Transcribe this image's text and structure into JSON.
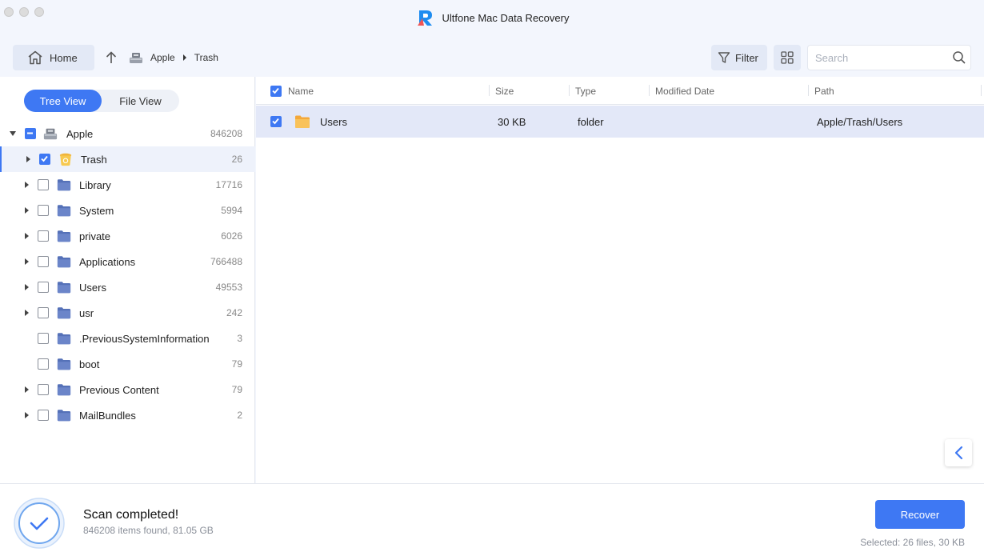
{
  "app": {
    "title": "Ultfone Mac Data Recovery"
  },
  "toolbar": {
    "home_label": "Home",
    "breadcrumb": [
      "Apple",
      "Trash"
    ],
    "filter_label": "Filter",
    "search_placeholder": "Search"
  },
  "left": {
    "tabs": [
      {
        "label": "Tree View",
        "active": true
      },
      {
        "label": "File View",
        "active": false
      }
    ],
    "root": {
      "label": "Apple",
      "count": "846208",
      "state": "partial",
      "icon": "disk-icon"
    },
    "items": [
      {
        "label": "Trash",
        "count": "26",
        "checked": true,
        "expandable": true,
        "selected": true,
        "icon": "trash-icon"
      },
      {
        "label": "Library",
        "count": "17716",
        "checked": false,
        "expandable": true,
        "icon": "folder-icon"
      },
      {
        "label": "System",
        "count": "5994",
        "checked": false,
        "expandable": true,
        "icon": "folder-icon"
      },
      {
        "label": "private",
        "count": "6026",
        "checked": false,
        "expandable": true,
        "icon": "folder-icon"
      },
      {
        "label": "Applications",
        "count": "766488",
        "checked": false,
        "expandable": true,
        "icon": "folder-icon"
      },
      {
        "label": "Users",
        "count": "49553",
        "checked": false,
        "expandable": true,
        "icon": "folder-icon"
      },
      {
        "label": "usr",
        "count": "242",
        "checked": false,
        "expandable": true,
        "icon": "folder-icon"
      },
      {
        "label": ".PreviousSystemInformation",
        "count": "3",
        "checked": false,
        "expandable": false,
        "icon": "folder-icon"
      },
      {
        "label": "boot",
        "count": "79",
        "checked": false,
        "expandable": false,
        "icon": "folder-icon"
      },
      {
        "label": "Previous Content",
        "count": "79",
        "checked": false,
        "expandable": true,
        "icon": "folder-icon"
      },
      {
        "label": "MailBundles",
        "count": "2",
        "checked": false,
        "expandable": true,
        "icon": "folder-icon"
      }
    ]
  },
  "table": {
    "columns": [
      "Name",
      "Size",
      "Type",
      "Modified Date",
      "Path"
    ],
    "rows": [
      {
        "name": "Users",
        "size": "30 KB",
        "type": "folder",
        "modified": "",
        "path": "Apple/Trash/Users",
        "checked": true
      }
    ]
  },
  "footer": {
    "status_title": "Scan completed!",
    "status_detail": "846208 items found, 81.05 GB",
    "recover_label": "Recover",
    "selected_info": "Selected: 26 files, 30 KB"
  },
  "colors": {
    "accent": "#3e78f3",
    "folder": "#6b85c9",
    "background": "#f3f6fd"
  }
}
